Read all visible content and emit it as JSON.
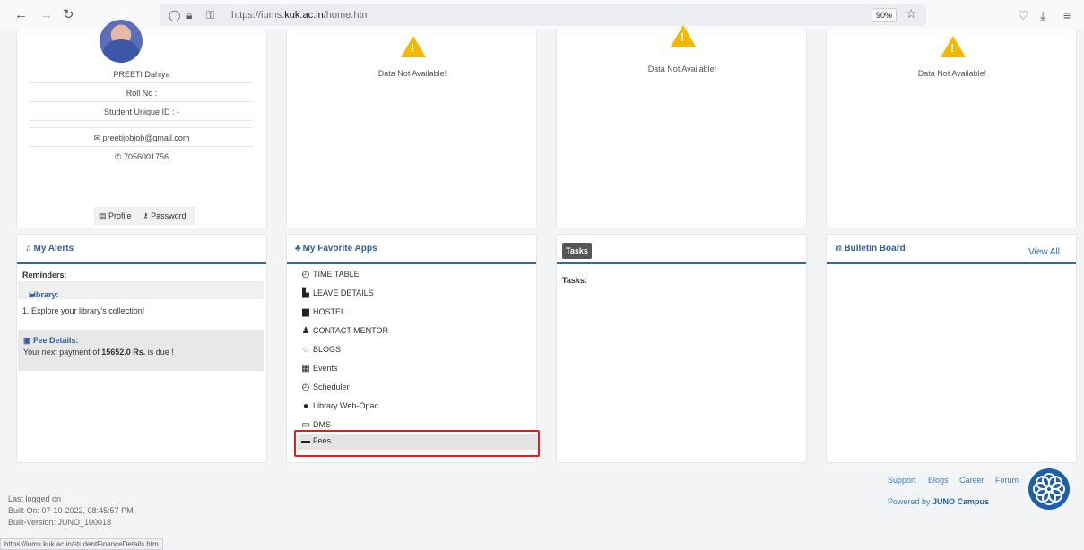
{
  "browser": {
    "url_prefix": "https://iums.",
    "url_domain": "kuk.ac.in",
    "url_path": "/home.htm",
    "zoom": "90%"
  },
  "profile": {
    "name": "PREETI Dahiya",
    "roll_no": "Roll No :",
    "unique_id": "Student Unique ID : -",
    "email": "preetijobjob@gmail.com",
    "phone": "7056001756",
    "profile_label": "Profile",
    "password_label": "Password"
  },
  "no_data_text": "Data Not Available!",
  "alerts": {
    "title": "My Alerts",
    "reminders": "Reminders:",
    "library_title": "Library:",
    "library_item": "1. Explore your library's collection!",
    "fee_title": "Fee Details:",
    "fee_prefix": "Your next payment of ",
    "fee_amount": "15652.0 Rs.",
    "fee_suffix": " is due !"
  },
  "apps": {
    "title": "My Favorite Apps",
    "items": [
      {
        "label": "TIME TABLE",
        "icon": "clock-icon"
      },
      {
        "label": "LEAVE DETAILS",
        "icon": "file-icon"
      },
      {
        "label": "HOSTEL",
        "icon": "building-icon"
      },
      {
        "label": "CONTACT MENTOR",
        "icon": "person-icon"
      },
      {
        "label": "BLOGS",
        "icon": "comments-icon"
      },
      {
        "label": "Events",
        "icon": "calendar-icon"
      },
      {
        "label": "Scheduler",
        "icon": "clock-icon"
      },
      {
        "label": "Library Web-Opac",
        "icon": "globe-icon"
      },
      {
        "label": "DMS",
        "icon": "folder-icon"
      },
      {
        "label": "Fees",
        "icon": "credit-card-icon"
      }
    ]
  },
  "tasks": {
    "badge": "Tasks",
    "label": "Tasks:"
  },
  "bulletin": {
    "title": "Bulletin Board",
    "view_all": "View All"
  },
  "footer": {
    "last_logged": "Last logged on",
    "built_on": "Built-On: 07-10-2022, 08:45:57 PM",
    "built_version": "Built-Version: JUNO_100018",
    "links": [
      "Support",
      "Blogs",
      "Career",
      "Forum"
    ],
    "powered_prefix": "Powered by ",
    "powered_brand": "JUNO Campus",
    "status_url": "https://iums.kuk.ac.in/studentFinanceDetails.htm"
  }
}
